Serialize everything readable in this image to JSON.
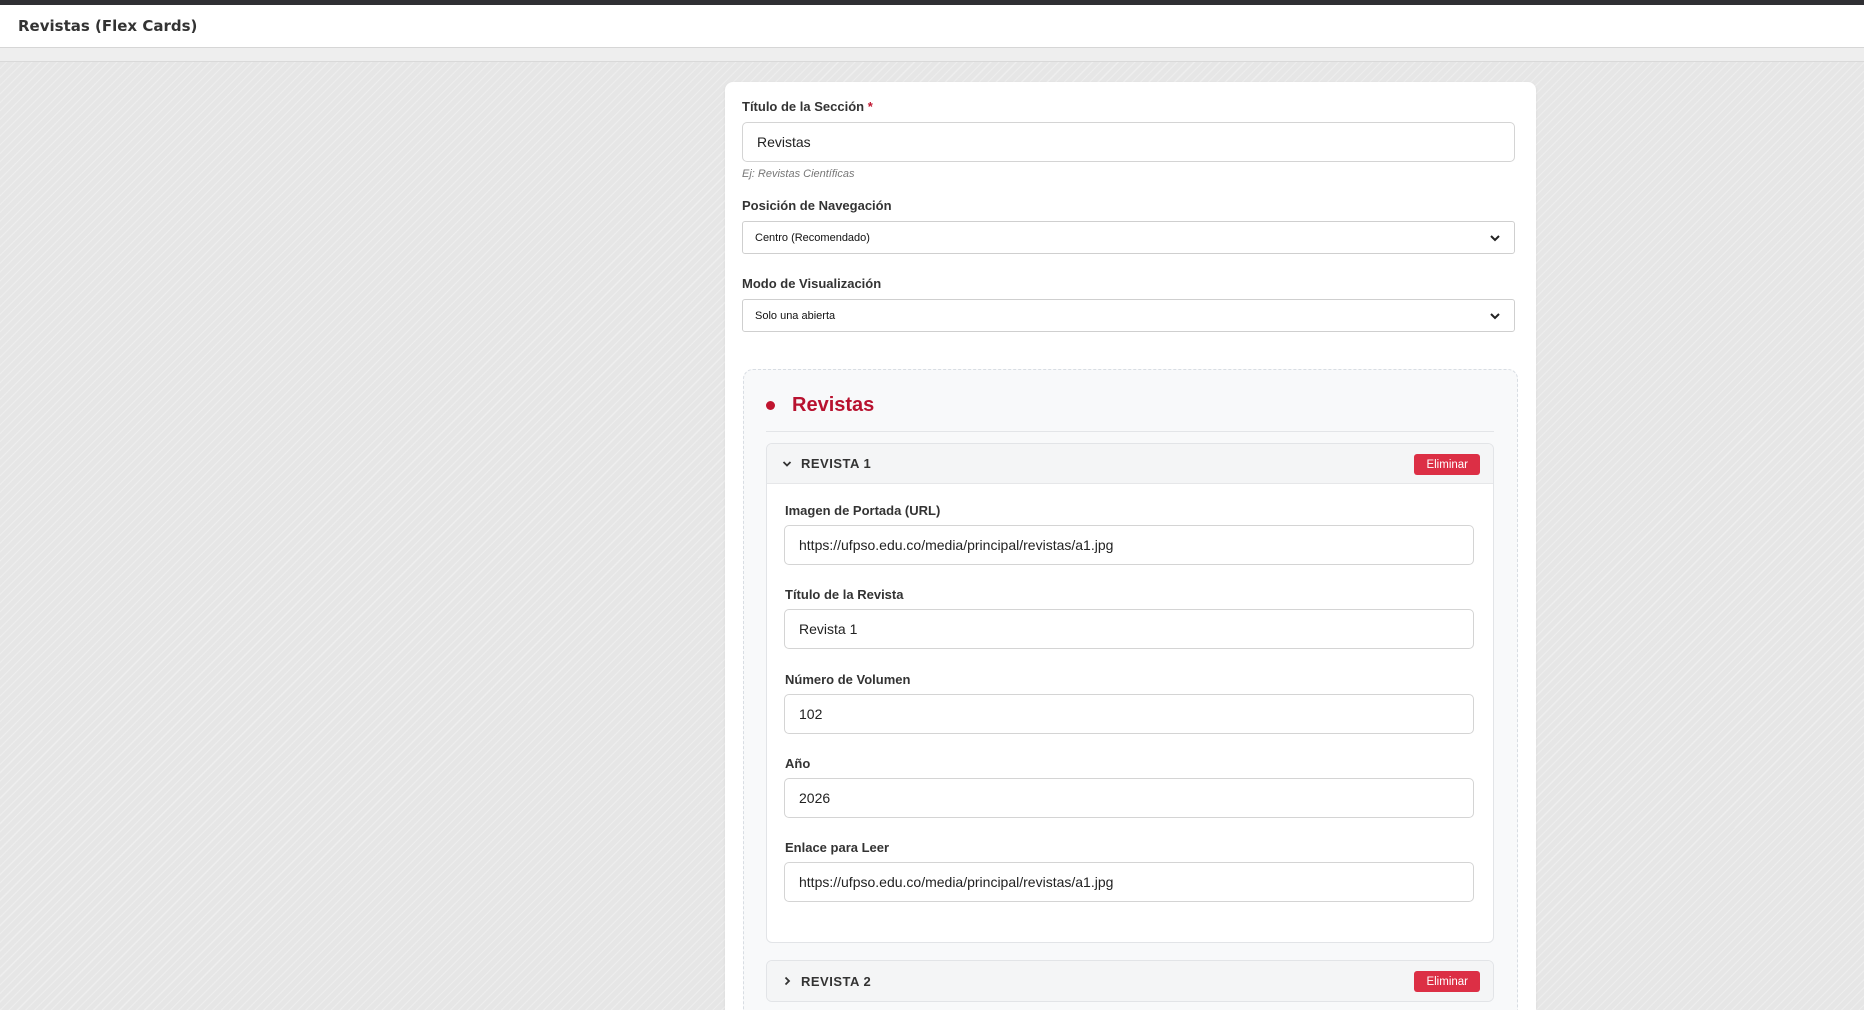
{
  "header": {
    "title": "Revistas (Flex Cards)"
  },
  "form": {
    "section_title_label": "Título de la Sección",
    "required_mark": "*",
    "section_title_value": "Revistas",
    "section_title_hint": "Ej: Revistas Científicas",
    "nav_position_label": "Posición de Navegación",
    "nav_position_value": "Centro (Recomendado)",
    "view_mode_label": "Modo de Visualización",
    "view_mode_value": "Solo una abierta"
  },
  "section": {
    "title": "Revistas",
    "items": [
      {
        "title": "REVISTA 1",
        "expanded": true,
        "delete_label": "Eliminar",
        "fields": {
          "cover_label": "Imagen de Portada (URL)",
          "cover_value": "https://ufpso.edu.co/media/principal/revistas/a1.jpg",
          "title_label": "Título de la Revista",
          "title_value": "Revista 1",
          "volume_label": "Número de Volumen",
          "volume_value": "102",
          "year_label": "Año",
          "year_value": "2026",
          "link_label": "Enlace para Leer",
          "link_value": "https://ufpso.edu.co/media/principal/revistas/a1.jpg"
        }
      },
      {
        "title": "REVISTA 2",
        "expanded": false,
        "delete_label": "Eliminar"
      }
    ]
  },
  "colors": {
    "accent": "#c0152f",
    "delete_button": "#dc2f45",
    "top_strip": "#2f2f33"
  }
}
